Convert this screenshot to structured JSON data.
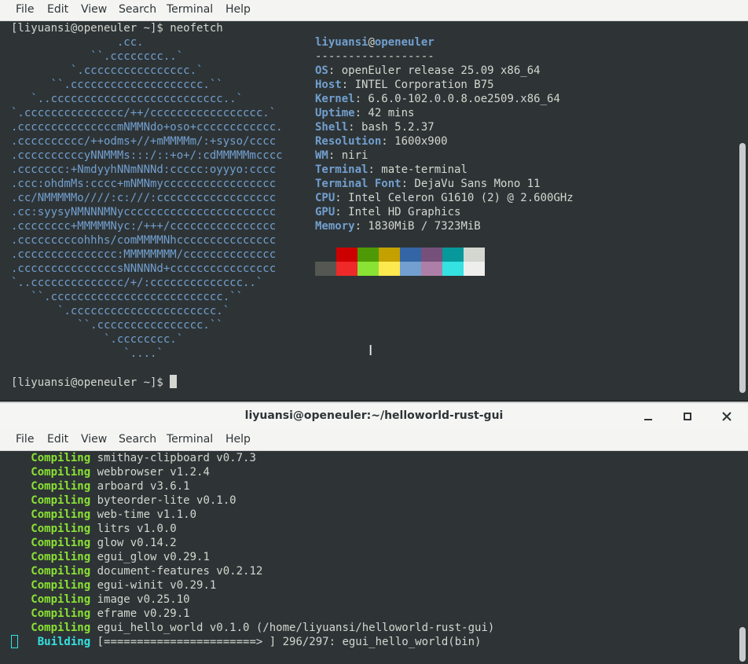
{
  "menu": [
    "File",
    "Edit",
    "View",
    "Search",
    "Terminal",
    "Help"
  ],
  "top": {
    "prompt_cmd": "[liyuansi@openeuler ~]$ neofetch",
    "prompt_end": "[liyuansi@openeuler ~]$ ",
    "ascii": [
      "                .cc.",
      "            ``.cccccccc..`",
      "         `.cccccccccccccccc.`",
      "      ``.cccccccccccccccccccc.``",
      "   `..cccccccccccccccccccccccccc..`",
      "`.ccccccccccccccc/++/ccccccccccccccccc.`",
      ".cccccccccccccccmNMMNdo+oso+cccccccccccc.",
      ".cccccccccc/++odms+//+mMMMMm/:+syso/cccc",
      ".ccccccccccyNNMMMs:::/::+o+/:cdMMMMMmcccc",
      ".ccccccc:+NmdyyhNNmNNNd:ccccc:oyyyo:cccc",
      ".ccc:ohdmMs:cccc+mNMNmyccccccccccccccccc",
      ".cc/NMMMMMo////:c:///:cccccccccccccccccc",
      ".cc:syysyNMNNNMNyccccccccccccccccccccccc",
      ".cccccccc+MMMMMNyc:/+++/cccccccccccccccc",
      ".cccccccccohhhs/comMMMMNhccccccccccccccc",
      ".ccccccccccccccc:MMMMMMMM/cccccccccccccc",
      ".cccccccccccccccsNNNNNd+cccccccccccccccc",
      "`..cccccccccccccc/+/:cccccccccccccc..`",
      "   ``.cccccccccccccccccccccccccc.``",
      "       `.cccccccccccccccccccccc.`",
      "          ``.cccccccccccccccc.``",
      "              `.cccccccc.`",
      "                 `....`"
    ],
    "info_user": "liyuansi",
    "info_at": "@",
    "info_host": "openeuler",
    "info_sep": "------------------",
    "info": [
      {
        "k": "OS",
        "v": ": openEuler release 25.09 x86_64"
      },
      {
        "k": "Host",
        "v": ": INTEL Corporation B75"
      },
      {
        "k": "Kernel",
        "v": ": 6.6.0-102.0.0.8.oe2509.x86_64"
      },
      {
        "k": "Uptime",
        "v": ": 42 mins"
      },
      {
        "k": "Shell",
        "v": ": bash 5.2.37"
      },
      {
        "k": "Resolution",
        "v": ": 1600x900"
      },
      {
        "k": "WM",
        "v": ": niri"
      },
      {
        "k": "Terminal",
        "v": ": mate-terminal"
      },
      {
        "k": "Terminal Font",
        "v": ": DejaVu Sans Mono 11"
      },
      {
        "k": "CPU",
        "v": ": Intel Celeron G1610 (2) @ 2.600GHz"
      },
      {
        "k": "GPU",
        "v": ": Intel HD Graphics"
      },
      {
        "k": "Memory",
        "v": ": 1830MiB / 7323MiB"
      }
    ],
    "palette_row1": [
      "#2e3436",
      "#cc0000",
      "#4e9a06",
      "#c4a000",
      "#3465a4",
      "#75507b",
      "#06989a",
      "#d3d7cf"
    ],
    "palette_row2": [
      "#555753",
      "#ef2929",
      "#8ae234",
      "#fce94f",
      "#729fcf",
      "#ad7fa8",
      "#34e2e2",
      "#eeeeec"
    ]
  },
  "bottom": {
    "title": "liyuansi@openeuler:~/helloworld-rust-gui",
    "lines": [
      {
        "s": "Compiling",
        "t": " smithay-clipboard v0.7.3"
      },
      {
        "s": "Compiling",
        "t": " webbrowser v1.2.4"
      },
      {
        "s": "Compiling",
        "t": " arboard v3.6.1"
      },
      {
        "s": "Compiling",
        "t": " byteorder-lite v0.1.0"
      },
      {
        "s": "Compiling",
        "t": " web-time v1.1.0"
      },
      {
        "s": "Compiling",
        "t": " litrs v1.0.0"
      },
      {
        "s": "Compiling",
        "t": " glow v0.14.2"
      },
      {
        "s": "Compiling",
        "t": " egui_glow v0.29.1"
      },
      {
        "s": "Compiling",
        "t": " document-features v0.2.12"
      },
      {
        "s": "Compiling",
        "t": " egui-winit v0.29.1"
      },
      {
        "s": "Compiling",
        "t": " image v0.25.10"
      },
      {
        "s": "Compiling",
        "t": " eframe v0.29.1"
      },
      {
        "s": "Compiling",
        "t": " egui_hello_world v0.1.0 (/home/liyuansi/helloworld-rust-gui)"
      }
    ],
    "building_label": "Building",
    "building_text": " [=======================> ] 296/297: egui_hello_world(bin)"
  }
}
